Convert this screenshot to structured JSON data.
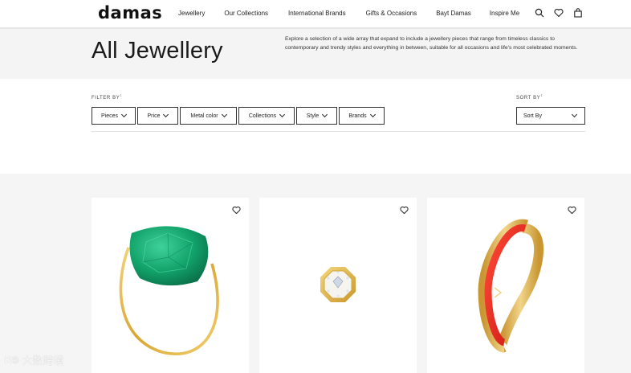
{
  "brand": {
    "logo_text": "damas"
  },
  "nav": {
    "items": [
      {
        "label": "Jewellery"
      },
      {
        "label": "Our Collections"
      },
      {
        "label": "International Brands"
      },
      {
        "label": "Gifts & Occasions"
      },
      {
        "label": "Bayt Damas"
      },
      {
        "label": "Inspire Me"
      }
    ]
  },
  "header_icons": [
    "search-icon",
    "heart-icon",
    "bag-icon"
  ],
  "hero": {
    "title": "All Jewellery",
    "description": "Explore a selection of a wide array that expand to include a jewellery pieces that range from timeless classics to contemporary and trendy styles and everything in between, suitable for all occasions and life's most celebrated moments."
  },
  "filters": {
    "label": "FILTER BY",
    "label_marker": "↕",
    "buttons": [
      "Pieces",
      "Price",
      "Metal color",
      "Collections",
      "Style",
      "Brands"
    ]
  },
  "sort": {
    "label": "SORT BY",
    "label_marker": "↕",
    "value": "Sort By"
  },
  "products": [
    {
      "product": "green-stone-ring"
    },
    {
      "product": "octagon-diamond-ring"
    },
    {
      "product": "red-enamel-bangle"
    }
  ],
  "colors": {
    "accent_gold": "#e2b441",
    "green_stone": "#11a06a",
    "red_enamel": "#e0241b"
  },
  "watermark": {
    "logo": "K®",
    "text": "大数跨境"
  }
}
